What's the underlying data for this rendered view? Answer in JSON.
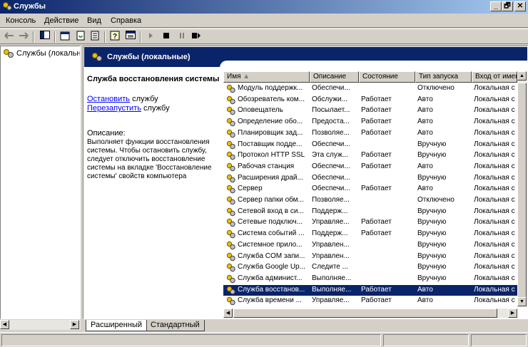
{
  "window": {
    "title": "Службы",
    "buttons": {
      "minimize": "_",
      "maximize": "🗗",
      "close": "✕"
    }
  },
  "menu": [
    {
      "label": "Консоль"
    },
    {
      "label": "Действие"
    },
    {
      "label": "Вид"
    },
    {
      "label": "Справка"
    }
  ],
  "tree": {
    "root_label": "Службы (локальные)"
  },
  "panel": {
    "header": "Службы (локальные)"
  },
  "detail": {
    "title": "Служба восстановления системы",
    "stop_link": "Остановить",
    "stop_suffix": " службу",
    "restart_link": "Перезапустить",
    "restart_suffix": " службу",
    "desc_label": "Описание:",
    "desc_text": "Выполняет функции восстановления системы. Чтобы остановить службу, следует отключить восстановление системы на вкладке 'Восстановление системы' свойств компьютера"
  },
  "columns": {
    "name": "Имя",
    "description": "Описание",
    "state": "Состояние",
    "startup": "Тип запуска",
    "logon": "Вход от имени"
  },
  "rows": [
    {
      "name": "Модуль поддержк...",
      "description": "Обеспечи...",
      "state": "",
      "startup": "Отключено",
      "logon": "Локальная с"
    },
    {
      "name": "Обозреватель ком...",
      "description": "Обслужи...",
      "state": "Работает",
      "startup": "Авто",
      "logon": "Локальная с"
    },
    {
      "name": "Оповещатель",
      "description": "Посылает...",
      "state": "Работает",
      "startup": "Авто",
      "logon": "Локальная с"
    },
    {
      "name": "Определение обо...",
      "description": "Предоста...",
      "state": "Работает",
      "startup": "Авто",
      "logon": "Локальная с"
    },
    {
      "name": "Планировщик зад...",
      "description": "Позволяе...",
      "state": "Работает",
      "startup": "Авто",
      "logon": "Локальная с"
    },
    {
      "name": "Поставщик подде...",
      "description": "Обеспечи...",
      "state": "",
      "startup": "Вручную",
      "logon": "Локальная с"
    },
    {
      "name": "Протокол HTTP SSL",
      "description": "Эта служ...",
      "state": "Работает",
      "startup": "Вручную",
      "logon": "Локальная с"
    },
    {
      "name": "Рабочая станция",
      "description": "Обеспечи...",
      "state": "Работает",
      "startup": "Авто",
      "logon": "Локальная с"
    },
    {
      "name": "Расширения драй...",
      "description": "Обеспечи...",
      "state": "",
      "startup": "Вручную",
      "logon": "Локальная с"
    },
    {
      "name": "Сервер",
      "description": "Обеспечи...",
      "state": "Работает",
      "startup": "Авто",
      "logon": "Локальная с"
    },
    {
      "name": "Сервер папки обм...",
      "description": "Позволяе...",
      "state": "",
      "startup": "Отключено",
      "logon": "Локальная с"
    },
    {
      "name": "Сетевой вход в си...",
      "description": "Поддерж...",
      "state": "",
      "startup": "Вручную",
      "logon": "Локальная с"
    },
    {
      "name": "Сетевые подключ...",
      "description": "Управляе...",
      "state": "Работает",
      "startup": "Вручную",
      "logon": "Локальная с"
    },
    {
      "name": "Система событий ...",
      "description": "Поддерж...",
      "state": "Работает",
      "startup": "Вручную",
      "logon": "Локальная с"
    },
    {
      "name": "Системное прило...",
      "description": "Управлен...",
      "state": "",
      "startup": "Вручную",
      "logon": "Локальная с"
    },
    {
      "name": "Служба COM запи...",
      "description": "Управлен...",
      "state": "",
      "startup": "Вручную",
      "logon": "Локальная с"
    },
    {
      "name": "Служба Google Up...",
      "description": "Следите ...",
      "state": "",
      "startup": "Вручную",
      "logon": "Локальная с"
    },
    {
      "name": "Служба админист...",
      "description": "Выполняе...",
      "state": "",
      "startup": "Вручную",
      "logon": "Локальная с"
    },
    {
      "name": "Служба восстанов...",
      "description": "Выполняе...",
      "state": "Работает",
      "startup": "Авто",
      "logon": "Локальная с",
      "selected": true
    },
    {
      "name": "Служба времени ...",
      "description": "Управляе...",
      "state": "Работает",
      "startup": "Авто",
      "logon": "Локальная с"
    }
  ],
  "tabs": {
    "extended": "Расширенный",
    "standard": "Стандартный"
  }
}
